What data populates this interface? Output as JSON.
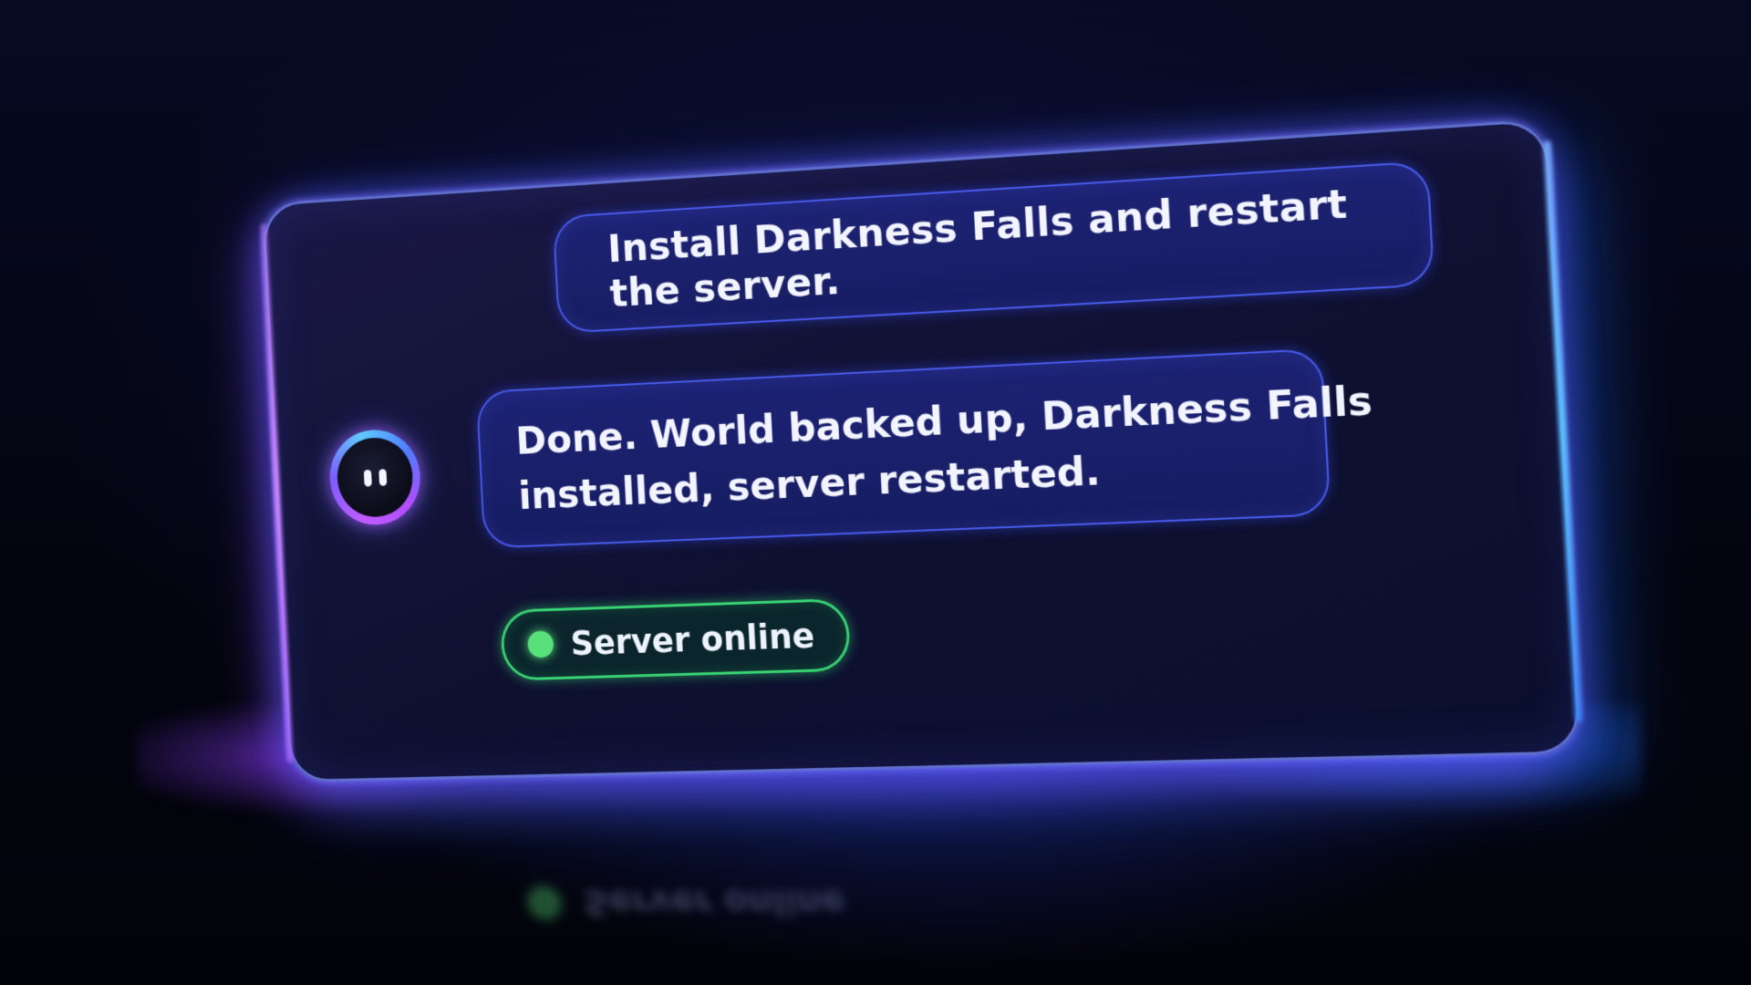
{
  "chat": {
    "user_message": "Install Darkness Falls and restart the server.",
    "assistant_message_lines": [
      "Done. World backed up, Darkness Falls",
      "installed, server restarted."
    ]
  },
  "status": {
    "label": "Server online",
    "color": "#58e07a"
  },
  "avatar": {
    "icon": "assistant-robot-face-icon"
  },
  "colors": {
    "accent_purple": "#a95cff",
    "accent_blue": "#3d7bff",
    "bubble_fill": "#1e2478",
    "status_green": "#58e07a"
  }
}
